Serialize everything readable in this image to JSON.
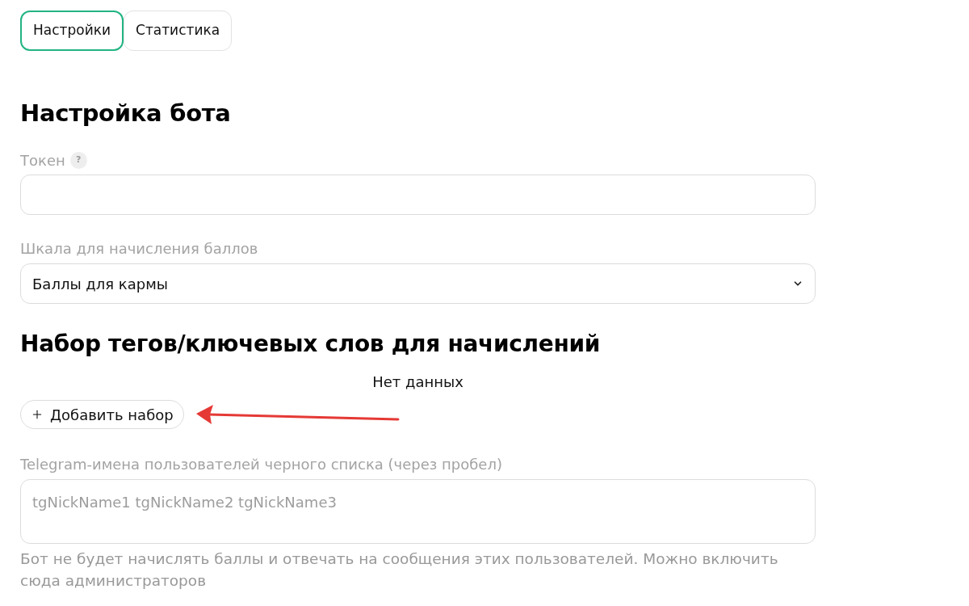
{
  "tabs": [
    {
      "label": "Настройки",
      "selected": true
    },
    {
      "label": "Статистика",
      "selected": false
    }
  ],
  "bot_settings": {
    "title": "Настройка бота",
    "token": {
      "label": "Токен",
      "help_mark": "?"
    },
    "scale": {
      "label": "Шкала для начисления баллов",
      "value": "Баллы для кармы"
    }
  },
  "tag_sets": {
    "title": "Набор тегов/ключевых слов для начислений",
    "empty_text": "Нет данных",
    "add_button": "Добавить набор"
  },
  "blacklist": {
    "label": "Telegram-имена пользователей черного списка (через пробел)",
    "placeholder": "tgNickName1 tgNickName2 tgNickName3",
    "hint": "Бот не будет начислять баллы и отвечать на сообщения этих пользователей. Можно включить сюда администраторов"
  }
}
